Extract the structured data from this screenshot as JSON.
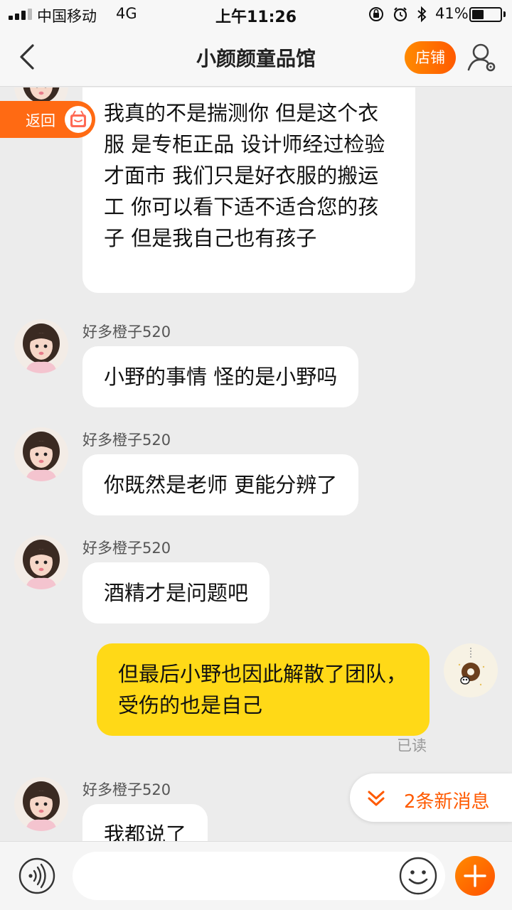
{
  "status_bar": {
    "carrier": "中国移动",
    "network": "4G",
    "time": "上午11:26",
    "battery_percent": "41%",
    "battery_level": 0.41,
    "icons": [
      "orientation-lock-icon",
      "alarm-icon",
      "bluetooth-icon"
    ]
  },
  "nav": {
    "title": "小颜颜童品馆",
    "shop_label": "店铺",
    "back_icon": "chevron-left-icon",
    "profile_icon": "person-settings-icon"
  },
  "back_pill": {
    "label": "返回"
  },
  "messages": [
    {
      "side": "left",
      "sender": "",
      "text": "我真的不是揣测你  但是这个衣服 是专柜正品 设计师经过检验才面市  我们只是好衣服的搬运工 你可以看下适不适合您的孩子 但是我自己也有孩子"
    },
    {
      "side": "left",
      "sender": "好多橙子520",
      "text": "小野的事情 怪的是小野吗"
    },
    {
      "side": "left",
      "sender": "好多橙子520",
      "text": "你既然是老师  更能分辨了"
    },
    {
      "side": "left",
      "sender": "好多橙子520",
      "text": "酒精才是问题吧"
    },
    {
      "side": "right",
      "sender": "",
      "text": "但最后小野也因此解散了团队，受伤的也是自己",
      "status": "已读"
    },
    {
      "side": "left",
      "sender": "好多橙子520",
      "text": "我都说了"
    }
  ],
  "new_messages_banner": {
    "label": "2条新消息"
  },
  "input_bar": {
    "value": "",
    "placeholder": ""
  },
  "colors": {
    "accent": "#ff6a00",
    "self_bubble": "#ffd917",
    "background": "#ececec"
  }
}
